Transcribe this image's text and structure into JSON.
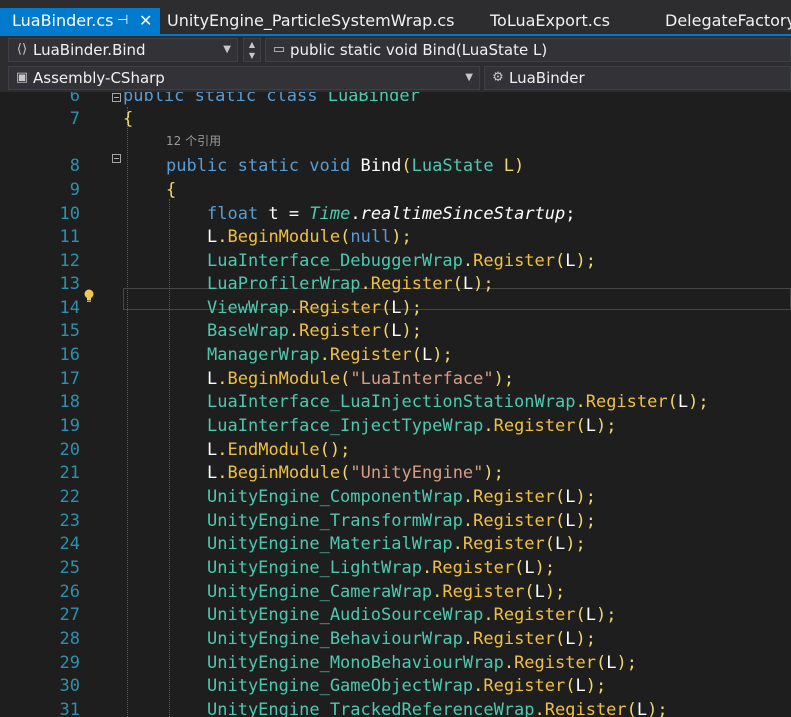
{
  "tabs": [
    {
      "label": "LuaBinder.cs",
      "active": true
    },
    {
      "label": "UnityEngine_ParticleSystemWrap.cs",
      "active": false
    },
    {
      "label": "ToLuaExport.cs",
      "active": false
    },
    {
      "label": "DelegateFactory.c",
      "active": false
    }
  ],
  "nav": {
    "member_combo": "LuaBinder.Bind",
    "method_combo": "public static void Bind(LuaState L)",
    "project_combo": "Assembly-CSharp",
    "type_combo": "LuaBinder"
  },
  "codelens": "12 个引用",
  "lines": [
    {
      "num": "6",
      "segments": [
        {
          "t": "public static class ",
          "c": "kw"
        },
        {
          "t": "LuaBinder",
          "c": "ty"
        }
      ]
    },
    {
      "num": "7",
      "segments": [
        {
          "t": "{",
          "c": "p"
        }
      ]
    },
    {
      "num": "8",
      "segments": [
        {
          "t": "public static void ",
          "c": "kw"
        },
        {
          "t": "Bind",
          "c": "fn"
        },
        {
          "t": "(",
          "c": "p"
        },
        {
          "t": "LuaState",
          "c": "ty"
        },
        {
          "t": " L)",
          "c": "p"
        }
      ]
    },
    {
      "num": "9",
      "segments": [
        {
          "t": "{",
          "c": "p"
        }
      ]
    },
    {
      "num": "10",
      "segments": [
        {
          "t": "float",
          "c": "kw"
        },
        {
          "t": " t = ",
          "c": "w"
        },
        {
          "t": "Time",
          "c": "ty"
        },
        {
          "t": ".",
          "c": "w"
        },
        {
          "t": "realtimeSinceStartup",
          "c": "f"
        },
        {
          "t": ";",
          "c": "w"
        }
      ]
    },
    {
      "num": "11",
      "segments": [
        {
          "t": "L",
          "c": "w"
        },
        {
          "t": ".",
          "c": "p"
        },
        {
          "t": "BeginModule",
          "c": "m"
        },
        {
          "t": "(",
          "c": "p"
        },
        {
          "t": "null",
          "c": "kw"
        },
        {
          "t": ");",
          "c": "p"
        }
      ]
    },
    {
      "num": "12",
      "segments": [
        {
          "t": "LuaInterface_DebuggerWrap",
          "c": "ty"
        },
        {
          "t": ".",
          "c": "p"
        },
        {
          "t": "Register",
          "c": "m"
        },
        {
          "t": "(",
          "c": "p"
        },
        {
          "t": "L",
          "c": "w"
        },
        {
          "t": ");",
          "c": "p"
        }
      ]
    },
    {
      "num": "13",
      "segments": [
        {
          "t": "LuaProfilerWrap",
          "c": "ty"
        },
        {
          "t": ".",
          "c": "p"
        },
        {
          "t": "Register",
          "c": "m"
        },
        {
          "t": "(",
          "c": "p"
        },
        {
          "t": "L",
          "c": "w"
        },
        {
          "t": ");",
          "c": "p"
        }
      ]
    },
    {
      "num": "14",
      "segments": [
        {
          "t": "ViewWrap",
          "c": "ty"
        },
        {
          "t": ".",
          "c": "p"
        },
        {
          "t": "Register",
          "c": "m"
        },
        {
          "t": "(",
          "c": "p"
        },
        {
          "t": "L",
          "c": "w"
        },
        {
          "t": ");",
          "c": "p"
        }
      ]
    },
    {
      "num": "15",
      "segments": [
        {
          "t": "BaseWrap",
          "c": "ty"
        },
        {
          "t": ".",
          "c": "p"
        },
        {
          "t": "Register",
          "c": "m"
        },
        {
          "t": "(",
          "c": "p"
        },
        {
          "t": "L",
          "c": "w"
        },
        {
          "t": ");",
          "c": "p"
        }
      ]
    },
    {
      "num": "16",
      "segments": [
        {
          "t": "ManagerWrap",
          "c": "ty"
        },
        {
          "t": ".",
          "c": "p"
        },
        {
          "t": "Register",
          "c": "m"
        },
        {
          "t": "(",
          "c": "p"
        },
        {
          "t": "L",
          "c": "w"
        },
        {
          "t": ");",
          "c": "p"
        }
      ]
    },
    {
      "num": "17",
      "segments": [
        {
          "t": "L",
          "c": "w"
        },
        {
          "t": ".",
          "c": "p"
        },
        {
          "t": "BeginModule",
          "c": "m"
        },
        {
          "t": "(",
          "c": "p"
        },
        {
          "t": "\"LuaInterface\"",
          "c": "s"
        },
        {
          "t": ");",
          "c": "p"
        }
      ]
    },
    {
      "num": "18",
      "segments": [
        {
          "t": "LuaInterface_LuaInjectionStationWrap",
          "c": "ty"
        },
        {
          "t": ".",
          "c": "p"
        },
        {
          "t": "Register",
          "c": "m"
        },
        {
          "t": "(",
          "c": "p"
        },
        {
          "t": "L",
          "c": "w"
        },
        {
          "t": ");",
          "c": "p"
        }
      ]
    },
    {
      "num": "19",
      "segments": [
        {
          "t": "LuaInterface_InjectTypeWrap",
          "c": "ty"
        },
        {
          "t": ".",
          "c": "p"
        },
        {
          "t": "Register",
          "c": "m"
        },
        {
          "t": "(",
          "c": "p"
        },
        {
          "t": "L",
          "c": "w"
        },
        {
          "t": ");",
          "c": "p"
        }
      ]
    },
    {
      "num": "20",
      "segments": [
        {
          "t": "L",
          "c": "w"
        },
        {
          "t": ".",
          "c": "p"
        },
        {
          "t": "EndModule",
          "c": "m"
        },
        {
          "t": "();",
          "c": "p"
        }
      ]
    },
    {
      "num": "21",
      "segments": [
        {
          "t": "L",
          "c": "w"
        },
        {
          "t": ".",
          "c": "p"
        },
        {
          "t": "BeginModule",
          "c": "m"
        },
        {
          "t": "(",
          "c": "p"
        },
        {
          "t": "\"UnityEngine\"",
          "c": "s"
        },
        {
          "t": ");",
          "c": "p"
        }
      ]
    },
    {
      "num": "22",
      "segments": [
        {
          "t": "UnityEngine_ComponentWrap",
          "c": "ty"
        },
        {
          "t": ".",
          "c": "p"
        },
        {
          "t": "Register",
          "c": "m"
        },
        {
          "t": "(",
          "c": "p"
        },
        {
          "t": "L",
          "c": "w"
        },
        {
          "t": ");",
          "c": "p"
        }
      ]
    },
    {
      "num": "23",
      "segments": [
        {
          "t": "UnityEngine_TransformWrap",
          "c": "ty"
        },
        {
          "t": ".",
          "c": "p"
        },
        {
          "t": "Register",
          "c": "m"
        },
        {
          "t": "(",
          "c": "p"
        },
        {
          "t": "L",
          "c": "w"
        },
        {
          "t": ");",
          "c": "p"
        }
      ]
    },
    {
      "num": "24",
      "segments": [
        {
          "t": "UnityEngine_MaterialWrap",
          "c": "ty"
        },
        {
          "t": ".",
          "c": "p"
        },
        {
          "t": "Register",
          "c": "m"
        },
        {
          "t": "(",
          "c": "p"
        },
        {
          "t": "L",
          "c": "w"
        },
        {
          "t": ");",
          "c": "p"
        }
      ]
    },
    {
      "num": "25",
      "segments": [
        {
          "t": "UnityEngine_LightWrap",
          "c": "ty"
        },
        {
          "t": ".",
          "c": "p"
        },
        {
          "t": "Register",
          "c": "m"
        },
        {
          "t": "(",
          "c": "p"
        },
        {
          "t": "L",
          "c": "w"
        },
        {
          "t": ");",
          "c": "p"
        }
      ]
    },
    {
      "num": "26",
      "segments": [
        {
          "t": "UnityEngine_CameraWrap",
          "c": "ty"
        },
        {
          "t": ".",
          "c": "p"
        },
        {
          "t": "Register",
          "c": "m"
        },
        {
          "t": "(",
          "c": "p"
        },
        {
          "t": "L",
          "c": "w"
        },
        {
          "t": ");",
          "c": "p"
        }
      ]
    },
    {
      "num": "27",
      "segments": [
        {
          "t": "UnityEngine_AudioSourceWrap",
          "c": "ty"
        },
        {
          "t": ".",
          "c": "p"
        },
        {
          "t": "Register",
          "c": "m"
        },
        {
          "t": "(",
          "c": "p"
        },
        {
          "t": "L",
          "c": "w"
        },
        {
          "t": ");",
          "c": "p"
        }
      ]
    },
    {
      "num": "28",
      "segments": [
        {
          "t": "UnityEngine_BehaviourWrap",
          "c": "ty"
        },
        {
          "t": ".",
          "c": "p"
        },
        {
          "t": "Register",
          "c": "m"
        },
        {
          "t": "(",
          "c": "p"
        },
        {
          "t": "L",
          "c": "w"
        },
        {
          "t": ");",
          "c": "p"
        }
      ]
    },
    {
      "num": "29",
      "segments": [
        {
          "t": "UnityEngine_MonoBehaviourWrap",
          "c": "ty"
        },
        {
          "t": ".",
          "c": "p"
        },
        {
          "t": "Register",
          "c": "m"
        },
        {
          "t": "(",
          "c": "p"
        },
        {
          "t": "L",
          "c": "w"
        },
        {
          "t": ");",
          "c": "p"
        }
      ]
    },
    {
      "num": "30",
      "segments": [
        {
          "t": "UnityEngine_GameObjectWrap",
          "c": "ty"
        },
        {
          "t": ".",
          "c": "p"
        },
        {
          "t": "Register",
          "c": "m"
        },
        {
          "t": "(",
          "c": "p"
        },
        {
          "t": "L",
          "c": "w"
        },
        {
          "t": ");",
          "c": "p"
        }
      ]
    },
    {
      "num": "31",
      "segments": [
        {
          "t": "UnityEngine_TrackedReferenceWrap",
          "c": "ty"
        },
        {
          "t": ".",
          "c": "p"
        },
        {
          "t": "Register",
          "c": "m"
        },
        {
          "t": "(",
          "c": "p"
        },
        {
          "t": "L",
          "c": "w"
        },
        {
          "t": ");",
          "c": "p"
        }
      ]
    }
  ],
  "colors": {
    "accent": "#007acc",
    "background": "#1e1e1e",
    "line_number": "#2b91af",
    "keyword": "#569cd6",
    "type": "#4ec9b0",
    "string": "#d69d85",
    "lightbulb": "#f2c94c"
  },
  "icons": [
    "pin-icon",
    "close-icon",
    "class-member-icon",
    "method-icon",
    "project-icon",
    "class-icon",
    "lightbulb-icon",
    "collapse-icon"
  ]
}
